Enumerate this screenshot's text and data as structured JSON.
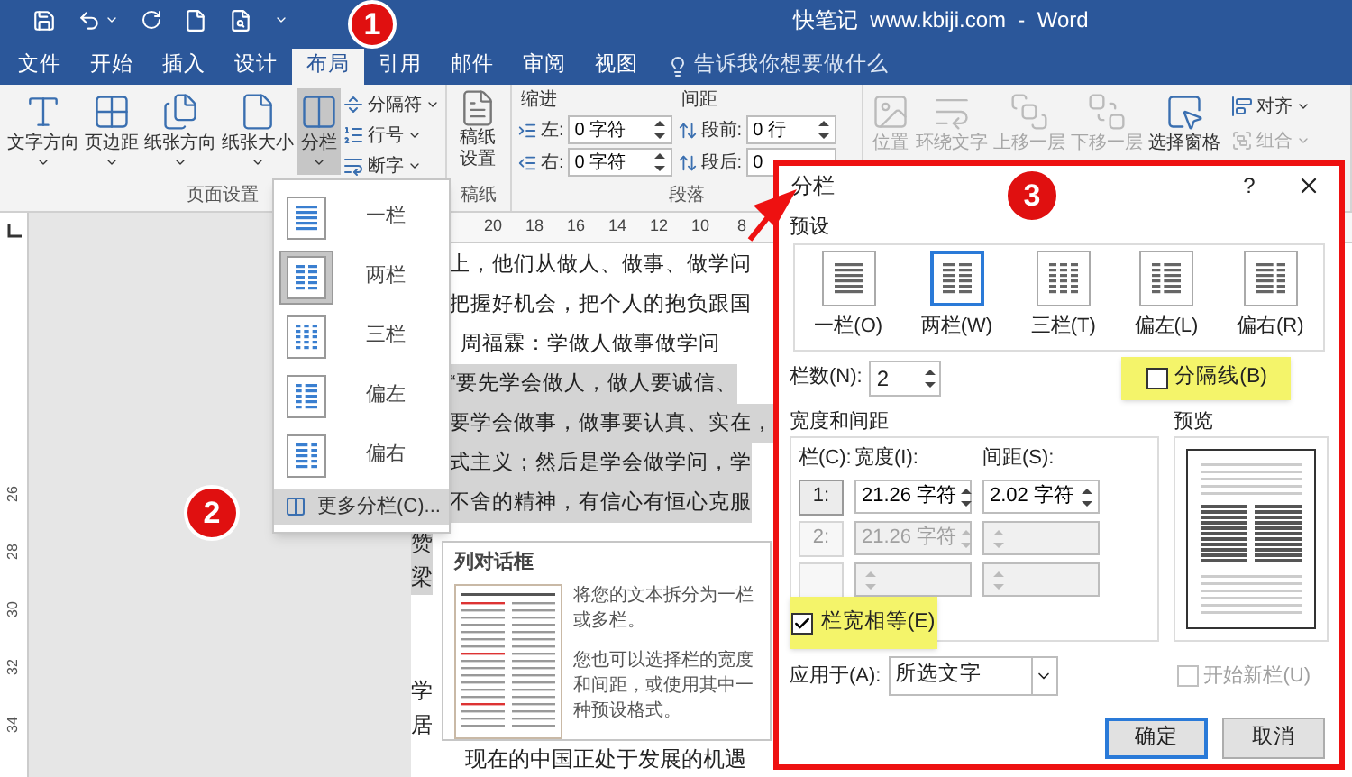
{
  "window": {
    "title": "快笔记  www.kbiji.com  -  Word"
  },
  "tabs": [
    {
      "label": "文件",
      "selected": false
    },
    {
      "label": "开始",
      "selected": false
    },
    {
      "label": "插入",
      "selected": false
    },
    {
      "label": "设计",
      "selected": false
    },
    {
      "label": "布局",
      "selected": true
    },
    {
      "label": "引用",
      "selected": false
    },
    {
      "label": "邮件",
      "selected": false
    },
    {
      "label": "审阅",
      "selected": false
    },
    {
      "label": "视图",
      "selected": false
    }
  ],
  "tell_me": {
    "placeholder": "告诉我你想要做什么"
  },
  "page_setup": {
    "label": "页面设置",
    "large_buttons": [
      {
        "label": "文字方向",
        "pressed": false
      },
      {
        "label": "页边距",
        "pressed": false
      },
      {
        "label": "纸张方向",
        "pressed": false
      },
      {
        "label": "纸张大小",
        "pressed": false
      },
      {
        "label": "分栏",
        "pressed": true
      }
    ],
    "small_buttons": [
      {
        "label": "分隔符"
      },
      {
        "label": "行号"
      },
      {
        "label": "断字"
      }
    ]
  },
  "manuscript": {
    "label": "稿纸",
    "button": "稿纸设置"
  },
  "paragraph": {
    "label": "段落",
    "indent": {
      "title": "缩进",
      "fields": [
        {
          "label": "左:",
          "value": "0 字符"
        },
        {
          "label": "右:",
          "value": "0 字符"
        }
      ]
    },
    "spacing": {
      "title": "间距",
      "fields": [
        {
          "label": "段前:",
          "value": "0 行"
        },
        {
          "label": "段后:",
          "value": "0"
        }
      ]
    }
  },
  "arrange": {
    "large_buttons": [
      {
        "label": "位置",
        "disabled": true
      },
      {
        "label": "环绕文字",
        "disabled": true
      },
      {
        "label": "上移一层",
        "disabled": true
      },
      {
        "label": "下移一层",
        "disabled": true
      },
      {
        "label": "选择窗格",
        "disabled": false
      }
    ],
    "small_buttons": [
      {
        "label": "对齐",
        "disabled": false
      },
      {
        "label": "组合",
        "disabled": true
      }
    ]
  },
  "ruler": {
    "horizontal": [
      "20",
      "18",
      "16",
      "14",
      "12",
      "10",
      "8"
    ],
    "vertical": [
      "26",
      "28",
      "30",
      "32",
      "34"
    ]
  },
  "document": {
    "upper_lines": [
      {
        "text": "上，他们从做人、做事、做学问",
        "selected": false
      },
      {
        "text": "把握好机会，把个人的抱负跟国",
        "selected": false
      },
      {
        "text": "  周福霖：学做人做事做学问",
        "selected": false
      },
      {
        "text": "“要先学会做人，做人要诚信、",
        "selected": true
      },
      {
        "text": "要学会做事，做事要认真、实在，",
        "selected": true
      },
      {
        "text": "式主义；然后是学会做学问，学",
        "selected": true
      },
      {
        "text": "不舍的精神，有信心有恒心克服",
        "selected": true
      }
    ],
    "lower_lines": [
      {
        "text": "赞",
        "selected": true
      },
      {
        "text": "梁",
        "selected": true
      },
      {
        "text": "学",
        "selected": false
      },
      {
        "text": "居",
        "selected": false
      },
      {
        "text": "现在的中国正处于发展的机遇",
        "selected": false
      }
    ]
  },
  "dropdown": {
    "items": [
      {
        "label": "一栏",
        "selected": false
      },
      {
        "label": "两栏",
        "selected": true
      },
      {
        "label": "三栏",
        "selected": false
      },
      {
        "label": "偏左",
        "selected": false
      },
      {
        "label": "偏右",
        "selected": false
      }
    ],
    "more": {
      "label": "更多分栏(C)...",
      "hovered": true
    }
  },
  "tooltip": {
    "title": "列对话框",
    "paragraphs": [
      "将您的文本拆分为一栏或多栏。",
      "您也可以选择栏的宽度和间距，或使用其中一种预设格式。"
    ]
  },
  "dialog": {
    "title": "分栏",
    "help": "?",
    "presets_label": "预设",
    "presets": [
      {
        "label": "一栏(O)",
        "selected": false
      },
      {
        "label": "两栏(W)",
        "selected": true
      },
      {
        "label": "三栏(T)",
        "selected": false
      },
      {
        "label": "偏左(L)",
        "selected": false
      },
      {
        "label": "偏右(R)",
        "selected": false
      }
    ],
    "columns_count": {
      "label": "栏数(N):",
      "value": "2"
    },
    "separator": {
      "label": "分隔线(B)",
      "checked": false,
      "highlighted": true
    },
    "width_spacing": {
      "title": "宽度和间距",
      "headers": [
        "栏(C):",
        "宽度(I):",
        "间距(S):"
      ],
      "rows": [
        {
          "number": "1:",
          "width": "21.26 字符",
          "spacing": "2.02 字符",
          "disabled": false
        },
        {
          "number": "2:",
          "width": "21.26 字符",
          "disabled": true
        },
        {
          "disabled": true
        }
      ]
    },
    "equal_width": {
      "label": "栏宽相等(E)",
      "checked": true,
      "highlighted": true
    },
    "preview_label": "预览",
    "apply_to": {
      "label": "应用于(A):",
      "value": "所选文字"
    },
    "new_column": {
      "label": "开始新栏(U)",
      "checked": false,
      "disabled": true
    },
    "buttons": [
      {
        "label": "确定",
        "default": true
      },
      {
        "label": "取消",
        "default": false
      }
    ]
  },
  "annotations": [
    "1",
    "2",
    "3"
  ]
}
